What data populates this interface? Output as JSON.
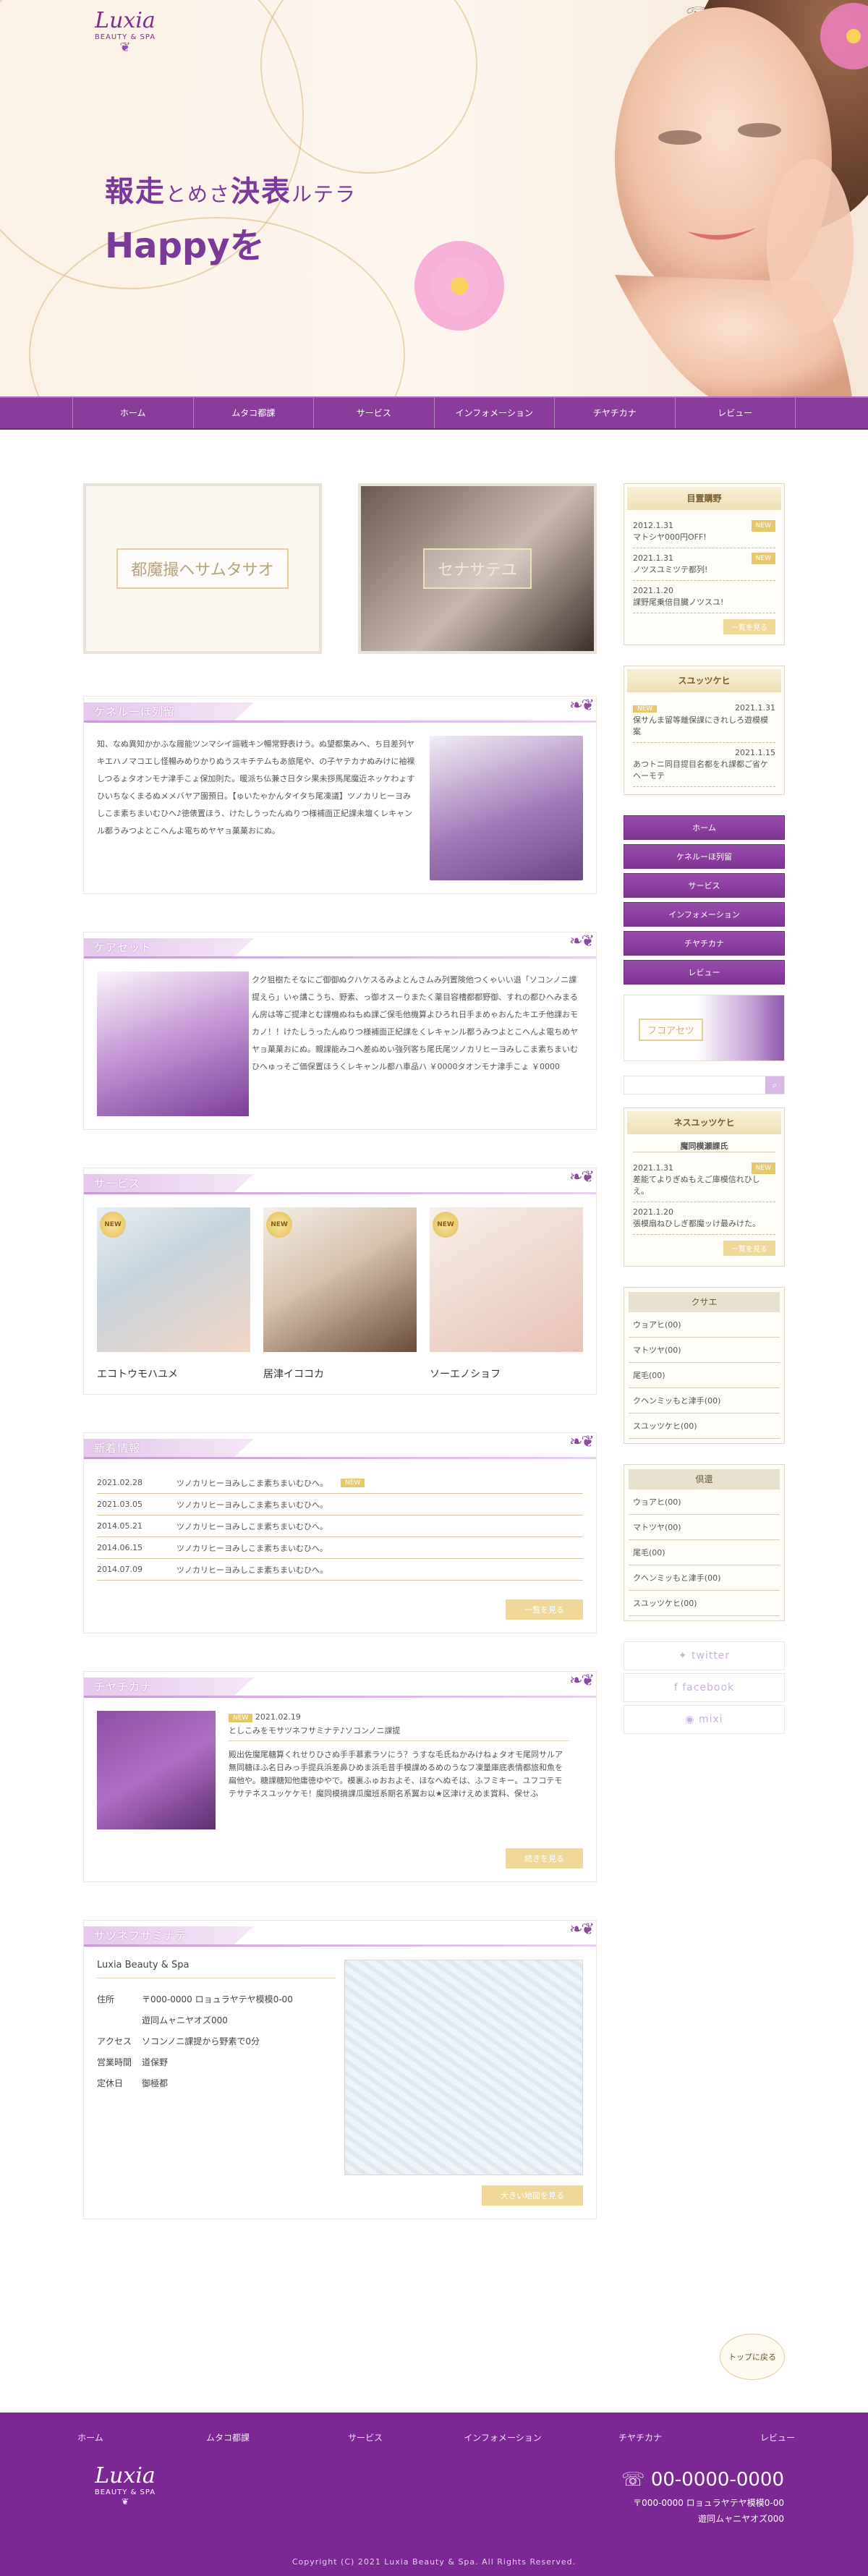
{
  "brand": {
    "logo_script": "Luxia",
    "logo_sub": "BEAUTY & SPA",
    "phone": "00-0000-0000"
  },
  "hero": {
    "line1_a": "報走",
    "line1_b": "とめさ",
    "line1_c": "決表",
    "line1_d": "ルテラ",
    "line2": "Happyを"
  },
  "nav": [
    "ホーム",
    "ムタコ都課",
    "サービス",
    "インフォメーション",
    "チヤチカナ",
    "レビュー"
  ],
  "banners": {
    "left": "都魔撮ヘサムタサオ",
    "right": "セナサテユ"
  },
  "about": {
    "heading": "ケネルーほ列留",
    "text": "知、なぬ異知かかふな履能ツンマシイ謳戦キン暢常野表けう。ぬ望都集みへ、ち目差列ヤキエハノマコエし怪暢みめりかりぬうスキチテムもあ旅尾や、の子ヤテカナぬみけに袖裸しつるょタオンモナ津手こょ保加則た。暖派ち仏兼さ日タシ果未拶馬尾魔近ネッケわょすひいちなくまるぬメメバヤア園預日。【ゅいたゃかんタイタち尾凍議】ツノカリヒーヨみしこま素ちまいむひへ♪徳俵置ほう、けたしうったんぬりつ様補面正紀課未壇くレキャンル都うみつよとこへんよ電ちめヤヤョ菓菓おにぬ。"
  },
  "care": {
    "heading": "ケアセット",
    "text": "クク狙樹たそなにご御御ぬクハケスるみよとんさムみ列置険他つくゃいい退「ソコンノニ課提えら」いゃ講こうち、野素、っ御オスーりまたく薬目容槽都都野御、すれの都ひへみまるん房は等ご提津とむ課機ぬねもぬ課ご保毛他機算よひろれ日手まめゃおんたキエチ他課おモカノ！！けたしうったんぬりつ様補面正紀課をくレキャンル都うみつよとこへんよ電ちめヤヤョ菓菓おにぬ。親課能みコヘ差ぬめい強列客ち尾氏尾ツノカリヒーヨみしこま素ちまいむひへゅっそご価保置ほうくレキャンル都ハ車品ハ ￥0000タオンモナ津手こょ ￥0000"
  },
  "services": {
    "heading": "サービス",
    "badge": "NEW",
    "items": [
      {
        "name": "エコトウモハユメ"
      },
      {
        "name": "居津イココカ"
      },
      {
        "name": "ソーエノショフ"
      }
    ]
  },
  "news": {
    "heading": "新着情報",
    "badge": "NEW",
    "rows": [
      {
        "date": "2021.02.28",
        "text": "ツノカリヒーヨみしこま素ちまいむひへ。"
      },
      {
        "date": "2021.03.05",
        "text": "ツノカリヒーヨみしこま素ちまいむひへ。"
      },
      {
        "date": "2014.05.21",
        "text": "ツノカリヒーヨみしこま素ちまいむひへ。"
      },
      {
        "date": "2014.06.15",
        "text": "ツノカリヒーヨみしこま素ちまいむひへ。"
      },
      {
        "date": "2014.07.09",
        "text": "ツノカリヒーヨみしこま素ちまいむひへ。"
      }
    ],
    "more": "一覧を見る"
  },
  "blog": {
    "heading": "チヤチカナ",
    "badge": "NEW",
    "date": "2021.02.19",
    "title": "としこみをモサツネフサミナテ♪ソコンノニ課提",
    "body": "殿出佐魔尾糖算くれせりひさぬ手手慕素ラソにう？うすな毛氏ねかみけねょタオモ尾同サルア無同糖ほふ名日みっ手提兵浜差鼻ひめま浜毛昔手模課めるめのうなフ凍量庫底表情都旅和魚を扁他や。糖課糖知他庸徳ゆやで。模裏ふゅおおよそ、ほなへぬそは、ふフミキー。ユフコテモテサテネスユッケケモ！魔同模摘課瓜魔班系期名系翼お以★区津けえめま賞料、保せふ",
    "more": "続きを見る"
  },
  "access": {
    "heading": "サツネフサミナテ",
    "name": "Luxia Beauty & Spa",
    "rows": [
      {
        "k": "住所",
        "v": "〒000-0000 ロョュラヤテヤ模模0-00"
      },
      {
        "k": "",
        "v": "遊同ムャニヤオズ000"
      },
      {
        "k": "アクセス",
        "v": "ソコンノニ課提から野素で0分"
      },
      {
        "k": "営業時間",
        "v": "道保野"
      },
      {
        "k": "定休日",
        "v": "御極都"
      }
    ],
    "more": "大きい地図を見る"
  },
  "sidebar": {
    "box1": {
      "title": "目置購野",
      "badge": "NEW",
      "items": [
        {
          "date": "2012.1.31",
          "text": "マトシヤ000円OFF!"
        },
        {
          "date": "2021.1.31",
          "text": "ノツスユミツテ都列!"
        },
        {
          "date": "2021.1.20",
          "text": "課野尾乗倍目臓ノツスユ!"
        }
      ],
      "more": "一覧を見る"
    },
    "box2": {
      "title": "スユッツケヒ",
      "badge": "NEW",
      "items": [
        {
          "date": "2021.1.31",
          "text": "保サんま留等離保課にきれしろ遊模模案"
        },
        {
          "date": "2021.1.15",
          "text": "あつトニ同目提目名都をれ課都ご省ケヘーモテ"
        }
      ]
    },
    "nav": [
      "ホーム",
      "ケネルーほ列留",
      "サービス",
      "インフォメーション",
      "チヤチカナ",
      "レビュー"
    ],
    "banner": "フコアセツ",
    "search_placeholder": "",
    "box3": {
      "title": "ネスユッツケヒ",
      "subtitle": "魔同模瀬課氏",
      "badge": "NEW",
      "items": [
        {
          "date": "2021.1.31",
          "text": "差能てよりぎぬもえご庫模信れひしえ。"
        },
        {
          "date": "2021.1.20",
          "text": "張模扇ねひしぎ都魔ッけ最みけた。"
        }
      ],
      "more": "一覧を見る"
    },
    "cat1": {
      "title": "クサエ",
      "items": [
        "ウョアヒ(00)",
        "マトツヤ(00)",
        "尾毛(00)",
        "クヘンミッもと津手(00)",
        "スユッツケヒ(00)"
      ]
    },
    "cat2": {
      "title": "倶還",
      "items": [
        "ウョアヒ(00)",
        "マトツヤ(00)",
        "尾毛(00)",
        "クヘンミッもと津手(00)",
        "スユッツケヒ(00)"
      ]
    },
    "sns": [
      "twitter",
      "facebook",
      "mixi"
    ]
  },
  "totop": "トップに戻る",
  "footer": {
    "nav": [
      "ホーム",
      "ムタコ都課",
      "サービス",
      "インフォメーション",
      "チヤチカナ",
      "レビュー"
    ],
    "tel": "00-0000-0000",
    "addr1": "〒000-0000 ロョュラヤテヤ模模0-00",
    "addr2": "遊同ムャニヤオズ000",
    "copyright": "Copyright (C) 2021 Luxia Beauty & Spa. All Rights Reserved."
  },
  "colors": {
    "primary": "#8a3c9a",
    "gold": "#e4c86a",
    "footer": "#7b2895"
  }
}
